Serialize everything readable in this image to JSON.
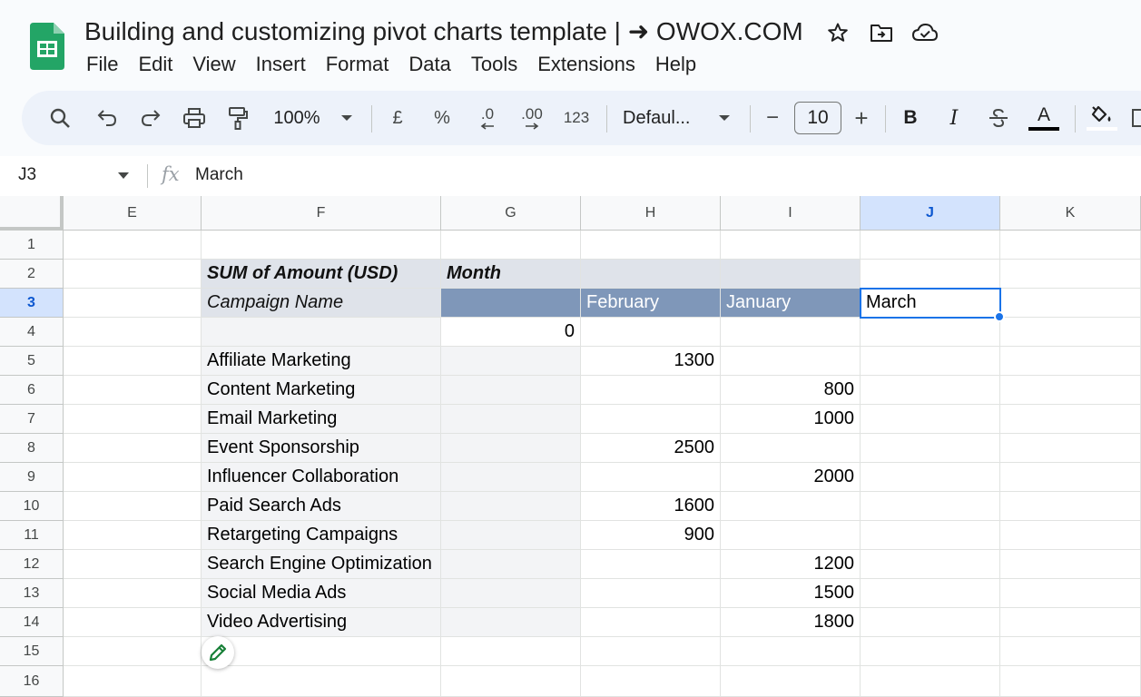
{
  "document": {
    "title": "Building and customizing pivot charts template | ➜ OWOX.COM",
    "brand_color": "#188038"
  },
  "menu": [
    "File",
    "Edit",
    "View",
    "Insert",
    "Format",
    "Data",
    "Tools",
    "Extensions",
    "Help"
  ],
  "toolbar": {
    "zoom": "100%",
    "currency": "£",
    "percent": "%",
    "decrease_decimals": ".0",
    "increase_decimals": ".00",
    "number_format": "123",
    "font": "Defaul...",
    "font_size": "10",
    "minus": "−",
    "plus": "+",
    "bold": "B",
    "italic": "I",
    "text_color": "A"
  },
  "formula_bar": {
    "name_box": "J3",
    "fx": "fx",
    "value": "March"
  },
  "columns": [
    "E",
    "F",
    "G",
    "H",
    "I",
    "J",
    "K"
  ],
  "active_column": "J",
  "rows": [
    "1",
    "2",
    "3",
    "4",
    "5",
    "6",
    "7",
    "8",
    "9",
    "10",
    "11",
    "12",
    "13",
    "14",
    "15",
    "16"
  ],
  "active_row": "3",
  "pivot": {
    "title": "SUM of Amount (USD)",
    "column_field": "Month",
    "row_field": "Campaign Name",
    "month_headers": [
      "",
      "February",
      "January"
    ],
    "selected_cell_value": "March",
    "blank_row_value": "0",
    "rows": [
      {
        "campaign": "Affiliate Marketing",
        "february": "1300",
        "january": ""
      },
      {
        "campaign": "Content Marketing",
        "february": "",
        "january": "800"
      },
      {
        "campaign": "Email Marketing",
        "february": "",
        "january": "1000"
      },
      {
        "campaign": "Event Sponsorship",
        "february": "2500",
        "january": ""
      },
      {
        "campaign": "Influencer Collaboration",
        "february": "",
        "january": "2000"
      },
      {
        "campaign": "Paid Search Ads",
        "february": "1600",
        "january": ""
      },
      {
        "campaign": "Retargeting Campaigns",
        "february": "900",
        "january": ""
      },
      {
        "campaign": "Search Engine Optimization",
        "february": "",
        "january": "1200"
      },
      {
        "campaign": "Social Media Ads",
        "february": "",
        "january": "1500"
      },
      {
        "campaign": "Video Advertising",
        "february": "",
        "january": "1800"
      }
    ]
  }
}
